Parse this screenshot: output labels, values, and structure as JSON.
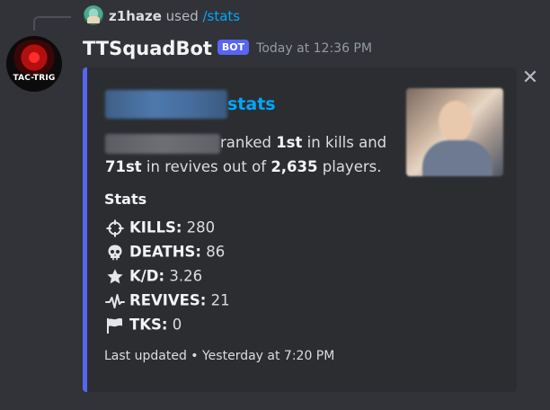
{
  "reply": {
    "username": "z1haze",
    "used_text": " used ",
    "command": "/stats"
  },
  "message": {
    "author": "TTSquadBot",
    "badge": "BOT",
    "timestamp": "Today at 12:36 PM",
    "avatar_text": "TAC-TRIG"
  },
  "embed": {
    "accent_color": "#5865f2",
    "title_suffix": "stats",
    "desc": {
      "text1": "ranked ",
      "kills_rank": "1st",
      "text2": " in kills and",
      "revives_rank": "71st",
      "text3": " in revives out of ",
      "players_count": "2,635",
      "text4": " players."
    },
    "stats_heading": "Stats",
    "stats": [
      {
        "icon": "crosshair-icon",
        "label": "KILLS:",
        "value": " 280"
      },
      {
        "icon": "skull-icon",
        "label": "DEATHS:",
        "value": " 86"
      },
      {
        "icon": "star-icon",
        "label": "K/D:",
        "value": " 3.26"
      },
      {
        "icon": "pulse-icon",
        "label": "REVIVES:",
        "value": " 21"
      },
      {
        "icon": "flag-icon",
        "label": "TKS:",
        "value": " 0"
      }
    ],
    "footer": "Last updated • Yesterday at 7:20 PM"
  }
}
